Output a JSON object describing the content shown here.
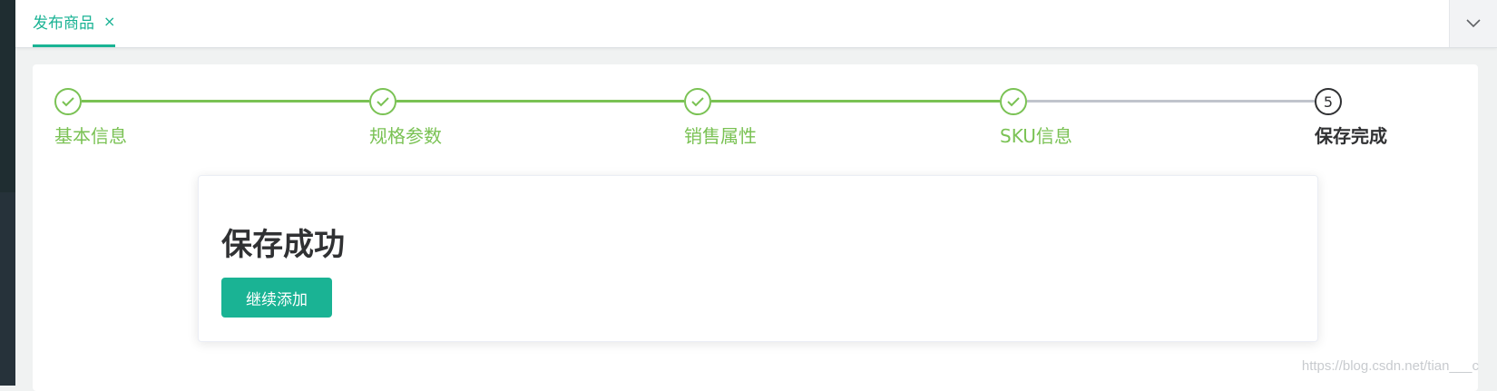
{
  "tabs": [
    {
      "label": "发布商品",
      "close": "×"
    }
  ],
  "steps": [
    {
      "title": "基本信息",
      "status": "finish"
    },
    {
      "title": "规格参数",
      "status": "finish"
    },
    {
      "title": "销售属性",
      "status": "finish"
    },
    {
      "title": "SKU信息",
      "status": "finish"
    },
    {
      "title": "保存完成",
      "status": "process",
      "number": "5"
    }
  ],
  "result": {
    "title": "保存成功",
    "continue_label": "继续添加"
  },
  "watermark": "https://blog.csdn.net/tian___c",
  "colors": {
    "accent": "#1ab394",
    "step_done": "#7ac254",
    "step_pending": "#c0c4cc",
    "text_dark": "#303133"
  },
  "icons": {
    "tab_close": "close-icon",
    "dropdown": "chevron-down-icon",
    "step_done": "check-icon"
  }
}
